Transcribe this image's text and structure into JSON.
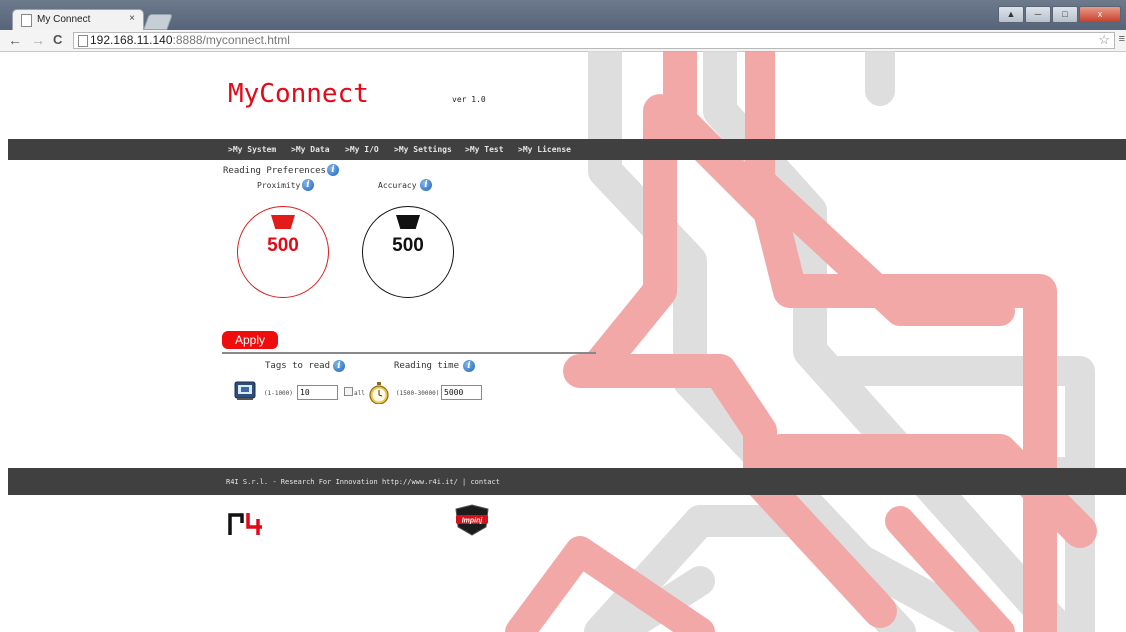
{
  "browser": {
    "tab_title": "My Connect",
    "tab_close": "×",
    "url_host": "192.168.11.140",
    "url_rest": ":8888/myconnect.html",
    "back_glyph": "←",
    "forward_glyph": "→",
    "reload_glyph": "C",
    "star_glyph": "☆",
    "menu_glyph": "≡",
    "window_buttons": [
      "▲",
      "─",
      "□",
      "x"
    ]
  },
  "header": {
    "title": "MyConnect",
    "version": "ver 1.0"
  },
  "nav": {
    "items": [
      ">My System",
      ">My Data",
      ">My I/O",
      ">My Settings",
      ">My Test",
      ">My License"
    ]
  },
  "preferences": {
    "title": "Reading Preferences",
    "proximity_label": "Proximity",
    "accuracy_label": "Accuracy",
    "proximity_value": "500",
    "accuracy_value": "500"
  },
  "apply_label": "Apply",
  "params": {
    "tags_label": "Tags to read",
    "tags_range": "(1-1000)",
    "tags_value": "10",
    "all_label": "all",
    "time_label": "Reading time",
    "time_range": "(1500-30000)",
    "time_value": "5000"
  },
  "footer": {
    "company": "R4I S.r.l. - Research For Innovation ",
    "link": "http://www.r4i.it/",
    "separator": " | ",
    "contact": "contact"
  },
  "badge_text": "Impinj",
  "colors": {
    "brand_red": "#e20a17",
    "bar": "#404040",
    "art_red": "#f19a9a",
    "art_grey": "#d9d9d9",
    "info_blue": "#2a6fc0"
  },
  "icons": {
    "info": "info-icon",
    "reader": "rfid-reader-icon",
    "stopwatch": "stopwatch-icon"
  }
}
